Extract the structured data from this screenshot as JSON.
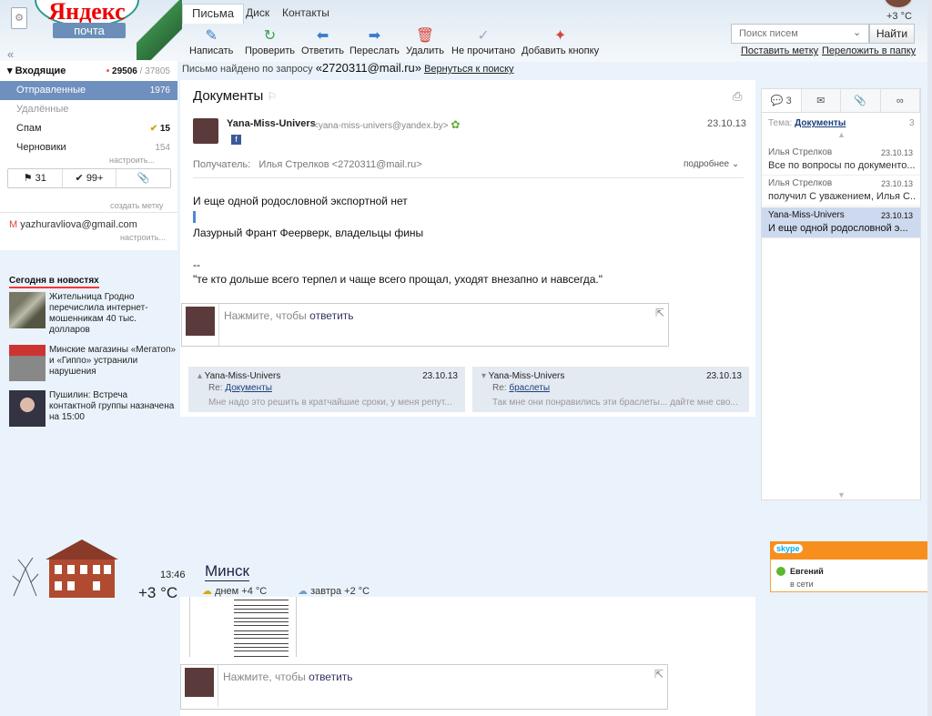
{
  "header": {
    "logo": "Яндекс",
    "logo_sub": "почта",
    "tabs": [
      {
        "label": "Письма"
      },
      {
        "label": "Диск"
      },
      {
        "label": "Контакты"
      }
    ],
    "weather": "+3 °C"
  },
  "toolbar": {
    "compose": "Написать",
    "check": "Проверить",
    "reply": "Ответить",
    "forward": "Переслать",
    "delete": "Удалить",
    "unread": "Не прочитано",
    "add_button": "Добавить кнопку"
  },
  "search": {
    "placeholder": "Поиск писем",
    "button": "Найти",
    "set_label": "Поставить метку",
    "move_folder": "Переложить в папку"
  },
  "found": {
    "text": "Письмо найдено по запросу",
    "query": "«2720311@mail.ru»",
    "back": "Вернуться к поиску"
  },
  "sidebar": {
    "collapse": "«",
    "inbox": {
      "label": "Входящие",
      "unread": "29506",
      "sep": "/",
      "total": "37805"
    },
    "items": [
      {
        "label": "Отправленные",
        "count": "1976"
      },
      {
        "label": "Удалённые",
        "count": ""
      },
      {
        "label": "Спам",
        "count": "15"
      },
      {
        "label": "Черновики",
        "count": "154"
      }
    ],
    "configure": "настроить...",
    "filters": {
      "flag": "31",
      "check": "99+",
      "clip": ""
    },
    "create_label": "создать метку",
    "gmail": "yazhuravliova@gmail.com",
    "configure2": "настроить..."
  },
  "news": {
    "title": "Сегодня в новостях",
    "items": [
      {
        "text": "Жительница Гродно перечислила интернет-мошенникам 40 тыс. долларов"
      },
      {
        "text": "Минские магазины «Мегатоп» и «Гиппо» устранили нарушения"
      },
      {
        "text": "Пушилин: Встреча контактной группы назначена на 15:00"
      }
    ]
  },
  "message": {
    "subject": "Документы",
    "sender_name": "Yana-Miss-Univers",
    "sender_email": "<yana-miss-univers@yandex.by>",
    "date": "23.10.13",
    "recipient_label": "Получатель:",
    "recipient": "Илья Стрелков <2720311@mail.ru>",
    "details": "подробнее",
    "body": [
      "И еще одной родословной экспортной нет",
      "Лазурный Франт Феерверк, владельцы фины",
      "--",
      "\"те кто дольше всего терпел и чаще всего прощал, уходят внезапно и навсегда.\""
    ],
    "reply_placeholder": "Нажмите, чтобы",
    "reply_link": "ответить"
  },
  "thread_cards": [
    {
      "name": "Yana-Miss-Univers",
      "date": "23.10.13",
      "re": "Re:",
      "subject": "Документы",
      "preview": "Мне надо это решить в кратчайшие сроки, у меня репут..."
    },
    {
      "name": "Yana-Miss-Univers",
      "date": "23.10.13",
      "re": "Re:",
      "subject": "браслеты",
      "preview": "Так мне они понравились эти браслеты... дайте мне сво..."
    }
  ],
  "right_panel": {
    "tabs": [
      "3",
      "✉",
      "📎",
      "∞"
    ],
    "theme_label": "Тема:",
    "theme": "Документы",
    "theme_count": "3",
    "items": [
      {
        "name": "Илья Стрелков",
        "date": "23.10.13",
        "text": "Все по вопросы по документо..."
      },
      {
        "name": "Илья Стрелков",
        "date": "23.10.13",
        "text": "получил С уважением, Илья С..."
      },
      {
        "name": "Yana-Miss-Univers",
        "date": "23.10.13",
        "text": "И еще одной родословной э..."
      }
    ]
  },
  "weather": {
    "time": "13:46",
    "temp": "+3 °C",
    "city": "Минск",
    "now": "днем +4 °C",
    "tomorrow": "завтра +2 °C"
  },
  "skype": {
    "logo": "skype",
    "name": "Евгений",
    "status": "в сети"
  }
}
